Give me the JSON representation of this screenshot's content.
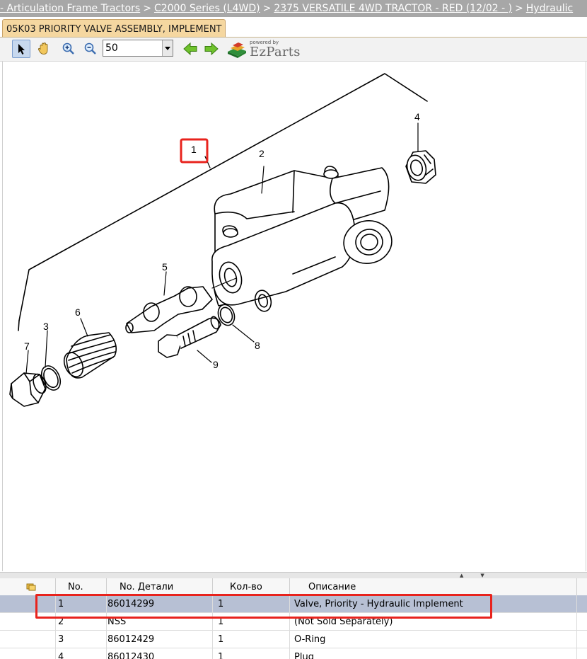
{
  "breadcrumb": {
    "items": [
      {
        "label": "- Articulation Frame Tractors",
        "link": true
      },
      {
        "label": "C2000 Series (L4WD)",
        "link": true
      },
      {
        "label": "2375 VERSATILE 4WD TRACTOR - RED (12/02 - )",
        "link": true
      },
      {
        "label": "Hydraulic",
        "link": true
      }
    ],
    "separator": ">"
  },
  "tab": {
    "label": "05K03 PRIORITY VALVE ASSEMBLY, IMPLEMENT"
  },
  "toolbar": {
    "zoom_value": "50",
    "logo_powered": "powered by",
    "logo_brand": "EzParts"
  },
  "diagram": {
    "callouts": [
      "1",
      "2",
      "3",
      "4",
      "5",
      "6",
      "7",
      "8",
      "9"
    ],
    "highlight_callout": "1"
  },
  "table": {
    "columns": [
      "No.",
      "No. Детали",
      "Кол-во",
      "Описание"
    ],
    "rows": [
      {
        "no": "1",
        "part": "86014299",
        "qty": "1",
        "desc": "Valve, Priority - Hydraulic Implement",
        "selected": true
      },
      {
        "no": "2",
        "part": "NSS",
        "qty": "1",
        "desc": "(Not Sold Separately)",
        "selected": false
      },
      {
        "no": "3",
        "part": "86012429",
        "qty": "1",
        "desc": "O-Ring",
        "selected": false
      },
      {
        "no": "4",
        "part": "86012430",
        "qty": "1",
        "desc": "Plug",
        "selected": false
      }
    ]
  },
  "colors": {
    "highlight": "#e8231d",
    "selected_row": "#b7c0d4",
    "tab_bg": "#f5d7a0",
    "breadcrumb_bg": "#a7a7a7"
  }
}
